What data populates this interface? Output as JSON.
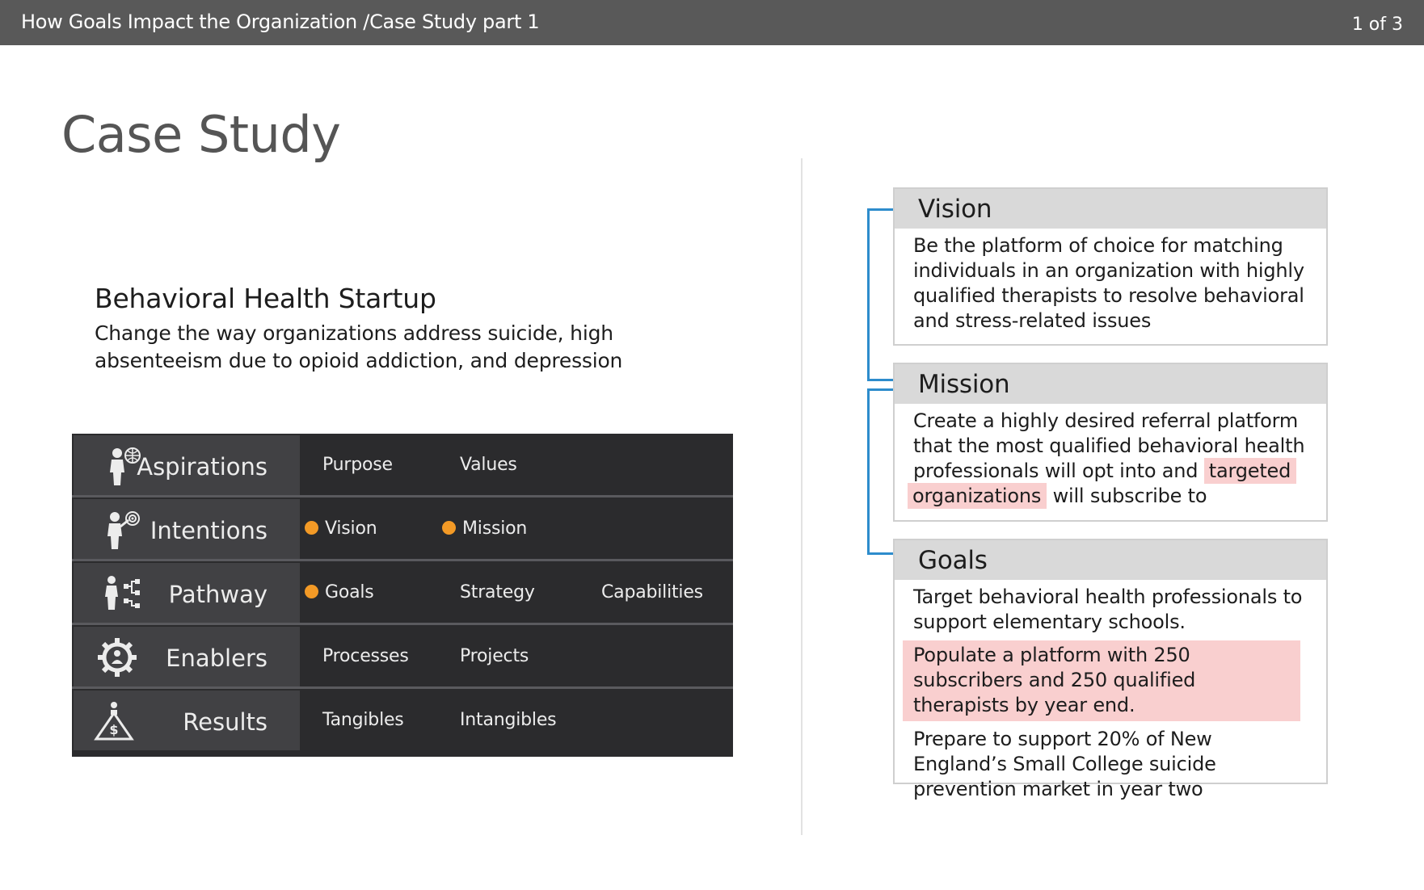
{
  "header": {
    "breadcrumb": "How Goals Impact the Organization /Case Study part 1",
    "pager": "1 of 3"
  },
  "page_title": "Case Study",
  "startup": {
    "title": "Behavioral Health Startup",
    "description": "Change the way organizations address suicide, high absenteeism due to opioid addiction, and depression"
  },
  "framework": {
    "rows": [
      {
        "label": "Aspirations",
        "icon": "person-globe-icon",
        "items": [
          {
            "text": "Purpose",
            "dot": false
          },
          {
            "text": "Values",
            "dot": false
          }
        ]
      },
      {
        "label": "Intentions",
        "icon": "person-target-icon",
        "items": [
          {
            "text": "Vision",
            "dot": true
          },
          {
            "text": "Mission",
            "dot": true
          }
        ]
      },
      {
        "label": "Pathway",
        "icon": "person-flowchart-icon",
        "items": [
          {
            "text": "Goals",
            "dot": true
          },
          {
            "text": "Strategy",
            "dot": false
          },
          {
            "text": "Capabilities",
            "dot": false
          }
        ]
      },
      {
        "label": "Enablers",
        "icon": "gear-people-icon",
        "items": [
          {
            "text": "Processes",
            "dot": false
          },
          {
            "text": "Projects",
            "dot": false
          }
        ]
      },
      {
        "label": "Results",
        "icon": "money-pyramid-icon",
        "items": [
          {
            "text": "Tangibles",
            "dot": false
          },
          {
            "text": "Intangibles",
            "dot": false
          }
        ]
      }
    ],
    "dot_color": "#f39a26"
  },
  "cards": {
    "vision": {
      "title": "Vision",
      "body": "Be the platform of choice for matching individuals in an organization with highly qualified therapists to resolve behavioral and stress-related issues"
    },
    "mission": {
      "title": "Mission",
      "body_before": "Create a highly desired referral platform that the most qualified behavioral health professionals will opt into and ",
      "body_highlight_1": "targeted",
      "body_highlight_2": "organizations",
      "body_after": " will subscribe to"
    },
    "goals": {
      "title": "Goals",
      "items": [
        "Target behavioral health professionals to support elementary schools.",
        "Populate a platform with 250 subscribers and 250 qualified therapists by year end.",
        "Prepare to support 20% of New England’s Small College suicide prevention market in year two"
      ]
    }
  },
  "colors": {
    "topbar": "#595959",
    "connector": "#2d8ccc",
    "highlight": "#f9cfcf",
    "framework_bg": "#2b2b2d",
    "framework_label_bg": "#414144"
  }
}
